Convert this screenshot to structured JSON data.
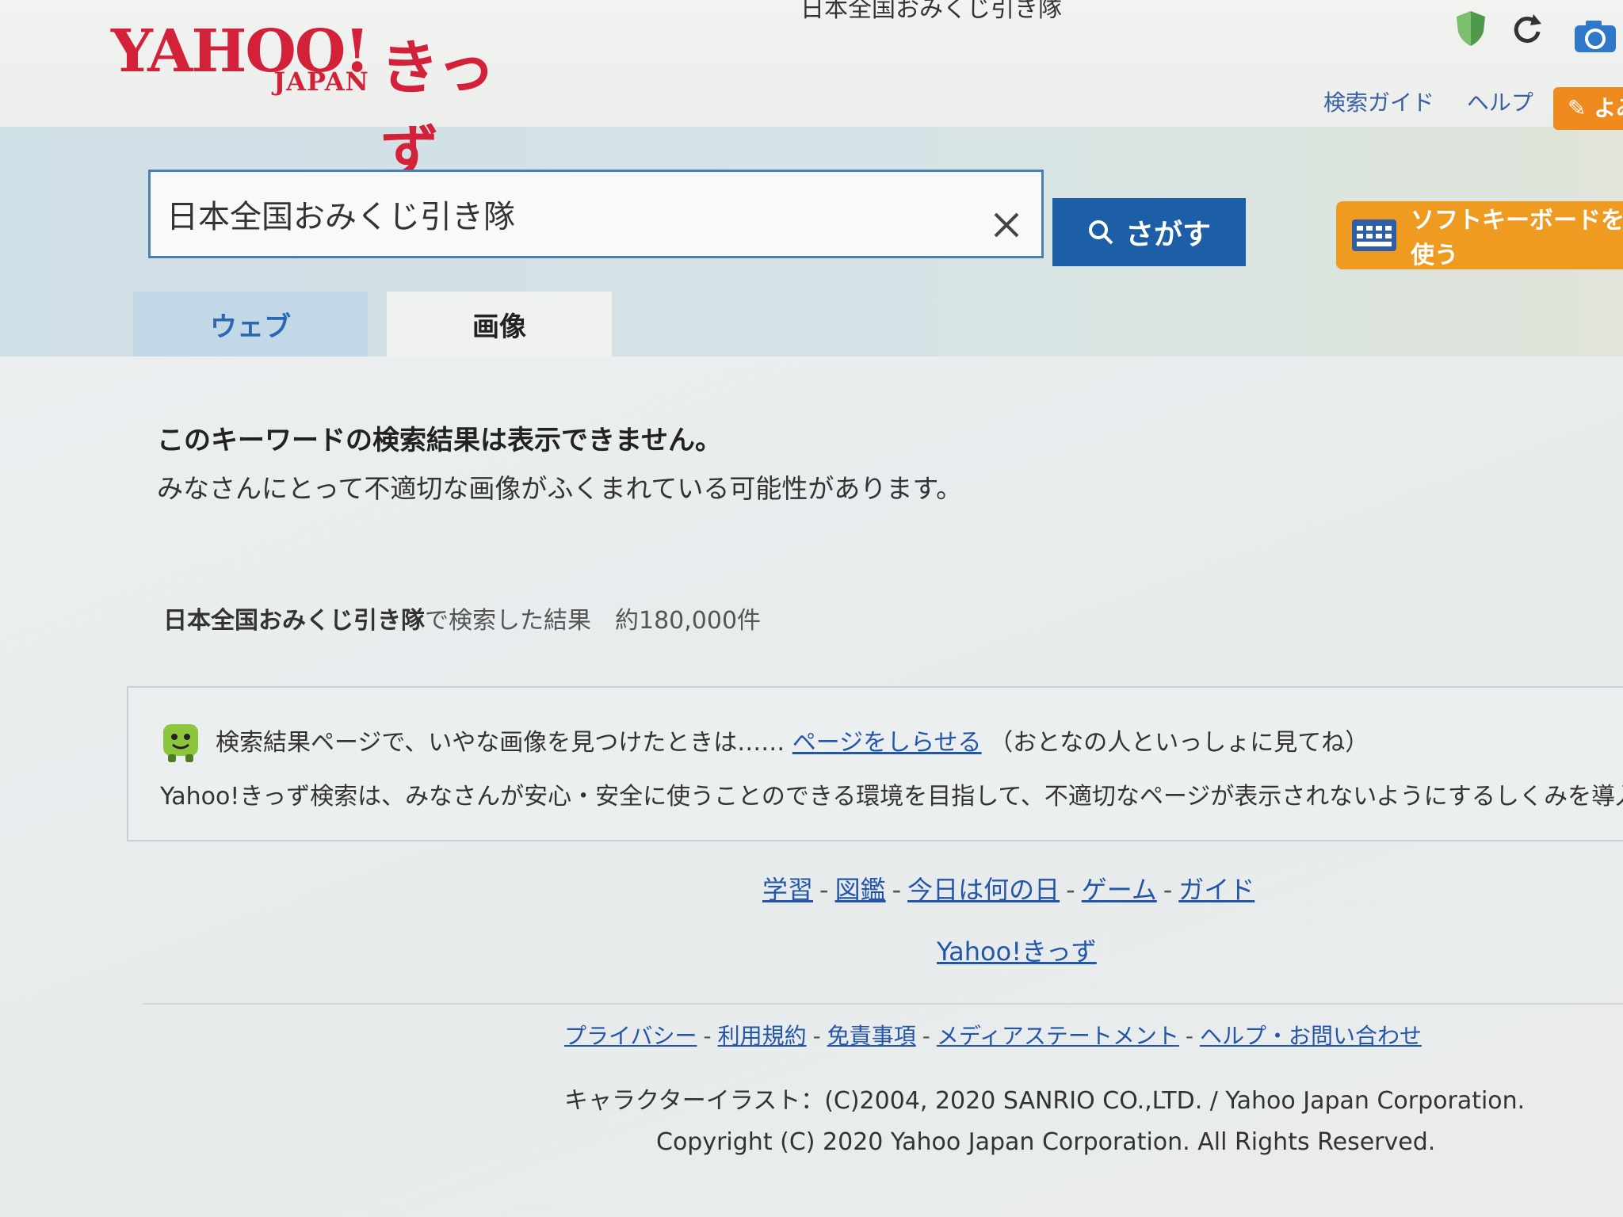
{
  "browser": {
    "window_title": "日本全国おみくじ引き隊"
  },
  "logo": {
    "yahoo": "YAHOO!",
    "japan": "JAPAN",
    "kids": "きっず"
  },
  "header": {
    "links": [
      "検索ガイド",
      "ヘルプ"
    ],
    "yomi_label": "よみ"
  },
  "search": {
    "value": "日本全国おみくじ引き隊",
    "button_label": "さがす",
    "softkey_label": "ソフトキーボードを使う"
  },
  "tabs": [
    {
      "label": "ウェブ",
      "active": true
    },
    {
      "label": "画像",
      "active": false
    }
  ],
  "notice": {
    "title": "このキーワードの検索結果は表示できません。",
    "body": "みなさんにとって不適切な画像がふくまれている可能性があります。"
  },
  "result": {
    "keyword": "日本全国おみくじ引き隊",
    "suffix": "で検索した結果",
    "count": "約180,000件"
  },
  "info_box": {
    "line1_prefix": "検索結果ページで、いやな画像を見つけたときは……",
    "line1_link": "ページをしらせる",
    "line1_suffix": "（おとなの人といっしょに見てね）",
    "line2": "Yahoo!きっず検索は、みなさんが安心・安全に使うことのできる環境を目指して、不適切なページが表示されないようにするしくみを導入し"
  },
  "footer": {
    "nav": [
      "学習",
      "図鑑",
      "今日は何の日",
      "ゲーム",
      "ガイド"
    ],
    "home_link": "Yahoo!きっず",
    "legal": [
      "プライバシー",
      "利用規約",
      "免責事項",
      "メディアステートメント",
      "ヘルプ・お問い合わせ"
    ],
    "credit": "キャラクターイラスト：(C)2004, 2020 SANRIO CO.,LTD. / Yahoo Japan Corporation.",
    "copyright": "Copyright (C) 2020 Yahoo Japan Corporation. All Rights Reserved."
  },
  "colors": {
    "brand_red": "#d3213a",
    "link_blue": "#2456a8",
    "button_blue": "#1c5fa6",
    "accent_orange": "#ef9b22"
  }
}
